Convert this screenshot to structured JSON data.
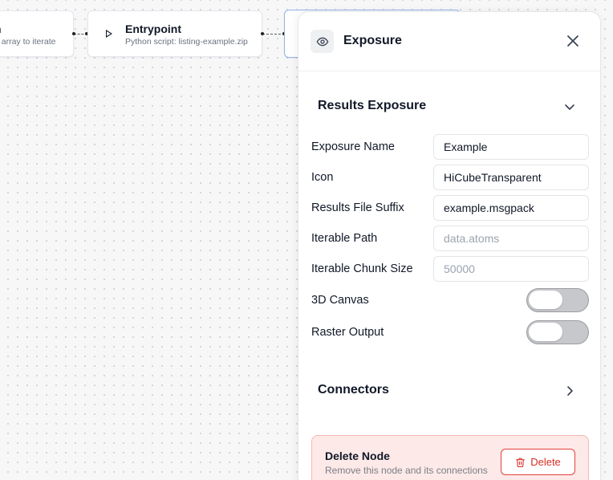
{
  "canvas": {
    "nodes": [
      {
        "id": "array",
        "title": "n",
        "subtitle": "n array to iterate"
      },
      {
        "id": "entrypoint",
        "title": "Entrypoint",
        "subtitle": "Python script: listing-example.zip",
        "icon": "play-icon"
      },
      {
        "id": "exposure",
        "title": "",
        "subtitle": ""
      }
    ]
  },
  "panel": {
    "title": "Exposure",
    "icon": "eye-icon",
    "close_icon": "close-icon",
    "results_section": {
      "title": "Results Exposure",
      "expanded": true,
      "fields": [
        {
          "label": "Exposure Name",
          "value": "Example",
          "placeholder": ""
        },
        {
          "label": "Icon",
          "value": "HiCubeTransparent",
          "placeholder": ""
        },
        {
          "label": "Results File Suffix",
          "value": "example.msgpack",
          "placeholder": ""
        },
        {
          "label": "Iterable Path",
          "value": "",
          "placeholder": "data.atoms"
        },
        {
          "label": "Iterable Chunk Size",
          "value": "",
          "placeholder": "50000"
        }
      ],
      "toggles": [
        {
          "label": "3D Canvas",
          "checked": false
        },
        {
          "label": "Raster Output",
          "checked": false
        }
      ]
    },
    "connectors_section": {
      "title": "Connectors",
      "expanded": false
    },
    "danger_zone": {
      "title": "Delete Node",
      "description": "Remove this node and its connections",
      "button_label": "Delete",
      "button_icon": "trash-icon"
    }
  },
  "colors": {
    "canvas_bg": "#f7f7f8",
    "selected_node_border": "#93b4ea",
    "danger_bg": "#fde9e8",
    "danger_border": "#f5b8b4",
    "danger_text": "#d92d24",
    "toggle_off": "#c7c8cb"
  }
}
